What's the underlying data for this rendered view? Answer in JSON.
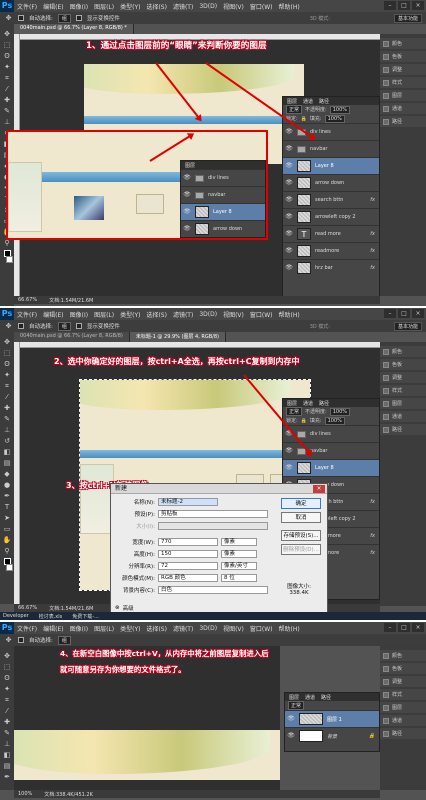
{
  "colors": {
    "accent_red": "#e00000",
    "selection_blue": "#5d7ea9",
    "ps_blue": "#31a8ff"
  },
  "app_logo": "Ps",
  "menu": [
    "文件(F)",
    "编辑(E)",
    "图像(I)",
    "图层(L)",
    "类型(Y)",
    "选择(S)",
    "滤镜(T)",
    "3D(D)",
    "视图(V)",
    "窗口(W)",
    "帮助(H)"
  ],
  "options": {
    "auto_select": "自动选择:",
    "auto_select_value": "组",
    "show_transform": "显示变换控件",
    "mode_3d": "3D 模式:",
    "workspace": "基本功能"
  },
  "panel1": {
    "tab": "0040main.psd @ 66.7% (Layer 8, RGB/8) *",
    "caption": "1、通过点击图层前的“眼睛”来判断你要的图层",
    "status_zoom": "66.67%",
    "status_doc": "文档:1.54M/21.6M",
    "layers_tabs": [
      "图层",
      "通道",
      "路径"
    ],
    "blend": "正常",
    "opacity_label": "不透明度:",
    "opacity": "100%",
    "lock": "锁定:",
    "fill_label": "填充:",
    "fill": "100%",
    "layers": [
      {
        "name": "div lines",
        "type": "folder",
        "selected": false,
        "fx": false
      },
      {
        "name": "navbar",
        "type": "folder",
        "selected": false,
        "fx": false
      },
      {
        "name": "Layer 8",
        "type": "layer",
        "selected": true,
        "fx": false
      },
      {
        "name": "arrow down",
        "type": "layer",
        "selected": false,
        "fx": false
      },
      {
        "name": "search bttn",
        "type": "layer",
        "selected": false,
        "fx": true
      },
      {
        "name": "arrowleft copy 2",
        "type": "layer",
        "selected": false,
        "fx": false
      },
      {
        "name": "read more",
        "type": "text",
        "selected": false,
        "fx": true
      },
      {
        "name": "readmore",
        "type": "layer",
        "selected": false,
        "fx": true
      },
      {
        "name": "hrz bar",
        "type": "layer",
        "selected": false,
        "fx": true
      }
    ],
    "inset_layers": [
      "div lines",
      "navbar",
      "Layer 8",
      "arrow down"
    ]
  },
  "dock": [
    {
      "label": "颜色",
      "icon": "color-icon"
    },
    {
      "label": "色板",
      "icon": "swatches-icon"
    },
    {
      "label": "调整",
      "icon": "adjustments-icon"
    },
    {
      "label": "样式",
      "icon": "styles-icon"
    },
    {
      "label": "图层",
      "icon": "layers-icon"
    },
    {
      "label": "通道",
      "icon": "channels-icon"
    },
    {
      "label": "路径",
      "icon": "paths-icon"
    }
  ],
  "panel2": {
    "tab": "0040main.psd @ 66.7% (Layer 8, RGB/8)",
    "tab2": "未标题-1 @ 29.9% (图层 4, RGB/8)",
    "caption_a": "2、选中你确定好的图层，按ctrl+A全选，再按ctrl+C复制到内存中",
    "caption_b": "3、按ctrl+N新建图像",
    "status_zoom": "66.67%",
    "status_doc": "文档:1.54M/21.6M",
    "layers": [
      {
        "name": "div lines",
        "type": "folder",
        "selected": false,
        "fx": false
      },
      {
        "name": "navbar",
        "type": "folder",
        "selected": false,
        "fx": false
      },
      {
        "name": "Layer 8",
        "type": "layer",
        "selected": true,
        "fx": false
      },
      {
        "name": "arrow down",
        "type": "layer",
        "selected": false,
        "fx": false
      },
      {
        "name": "search bttn",
        "type": "layer",
        "selected": false,
        "fx": true
      },
      {
        "name": "arrowleft copy 2",
        "type": "layer",
        "selected": false,
        "fx": false
      },
      {
        "name": "read more",
        "type": "text",
        "selected": false,
        "fx": true
      },
      {
        "name": "readmore",
        "type": "layer",
        "selected": false,
        "fx": true
      }
    ],
    "taskbar": [
      "Developer",
      "检讨表.xls",
      "免费下载-..."
    ]
  },
  "dialog": {
    "title": "新建",
    "name_label": "名称(N):",
    "name_value": "未标题-2",
    "preset_label": "预设(P):",
    "preset_value": "剪贴板",
    "size_label": "大小(I):",
    "width_label": "宽度(W):",
    "width_value": "770",
    "height_label": "高度(H):",
    "height_value": "150",
    "unit_px": "像素",
    "res_label": "分辨率(R):",
    "res_value": "72",
    "res_unit": "像素/英寸",
    "mode_label": "颜色模式(M):",
    "mode_value": "RGB 颜色",
    "depth_value": "8 位",
    "bg_label": "背景内容(C):",
    "bg_value": "白色",
    "advanced": "高级",
    "ok": "确定",
    "cancel": "取消",
    "save_preset": "存储预设(S)...",
    "delete_preset": "删除预设(D)...",
    "img_size_label": "图像大小:",
    "img_size_value": "338.4K"
  },
  "panel3": {
    "caption_line1": "4、在新空白图像中按ctrl+V，从内存中将之前图层复制进入后",
    "caption_line2": "就可随意另存为你想要的文件格式了。",
    "status_zoom": "100%",
    "status_doc": "文档:338.4K/451.2K",
    "blend": "正常",
    "layers": [
      {
        "name": "图层 1",
        "selected": true
      },
      {
        "name": "背景",
        "selected": false
      }
    ]
  }
}
